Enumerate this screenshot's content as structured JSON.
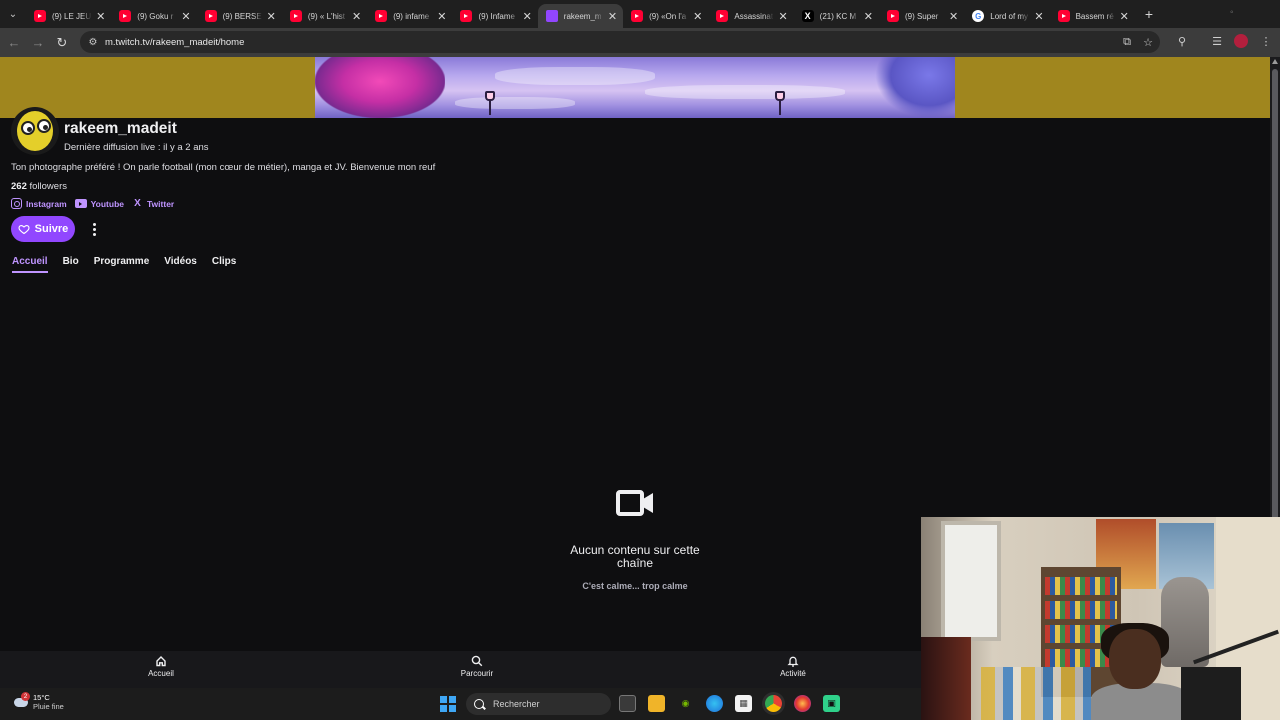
{
  "browser": {
    "tabs": [
      {
        "label": "(9) LE JEU",
        "favicon": "youtube",
        "active": false
      },
      {
        "label": "(9) Goku r",
        "favicon": "youtube",
        "active": false
      },
      {
        "label": "(9) BERSE",
        "favicon": "youtube",
        "active": false
      },
      {
        "label": "(9) « L'hist",
        "favicon": "youtube",
        "active": false
      },
      {
        "label": "(9) infame",
        "favicon": "youtube",
        "active": false
      },
      {
        "label": "(9) Infame",
        "favicon": "youtube",
        "active": false
      },
      {
        "label": "rakeem_m",
        "favicon": "twitch",
        "active": true
      },
      {
        "label": "(9) «On l'a",
        "favicon": "youtube",
        "active": false
      },
      {
        "label": "Assassinat",
        "favicon": "youtube",
        "active": false
      },
      {
        "label": "(21) KC M",
        "favicon": "x",
        "active": false
      },
      {
        "label": "(9) Super",
        "favicon": "youtube",
        "active": false
      },
      {
        "label": "Lord of my",
        "favicon": "google",
        "active": false
      },
      {
        "label": "Bassem ré",
        "favicon": "youtube",
        "active": false
      }
    ],
    "url": "m.twitch.tv/rakeem_madeit/home"
  },
  "channel": {
    "name": "rakeem_madeit",
    "last_live": "Dernière diffusion live : il y a 2 ans",
    "bio": "Ton photographe préféré ! On parle football (mon cœur de métier), manga et JV. Bienvenue mon reuf",
    "followers_count": "262",
    "followers_label": "followers",
    "socials": [
      {
        "label": "Instagram",
        "icon": "instagram-icon"
      },
      {
        "label": "Youtube",
        "icon": "youtube-icon"
      },
      {
        "label": "Twitter",
        "icon": "x-icon"
      }
    ],
    "follow_label": "Suivre",
    "tabs": [
      "Accueil",
      "Bio",
      "Programme",
      "Vidéos",
      "Clips"
    ],
    "active_tab": "Accueil",
    "banner_bg_color": "#a0861e",
    "accent_color": "#9147ff"
  },
  "empty_state": {
    "title": "Aucun contenu sur cette chaîne",
    "subtitle": "C'est calme... trop calme"
  },
  "bottom_nav": [
    {
      "label": "Accueil",
      "icon": "home-icon"
    },
    {
      "label": "Parcourir",
      "icon": "search-icon"
    },
    {
      "label": "Activité",
      "icon": "bell-icon"
    }
  ],
  "taskbar": {
    "weather_temp": "15°C",
    "weather_desc": "Pluie fine",
    "weather_badge": "2",
    "search_placeholder": "Rechercher",
    "apps": [
      "task-view-icon",
      "file-explorer-icon",
      "nvidia-icon",
      "edge-icon",
      "store-icon",
      "chrome-icon",
      "firefox-icon",
      "app-icon"
    ]
  }
}
